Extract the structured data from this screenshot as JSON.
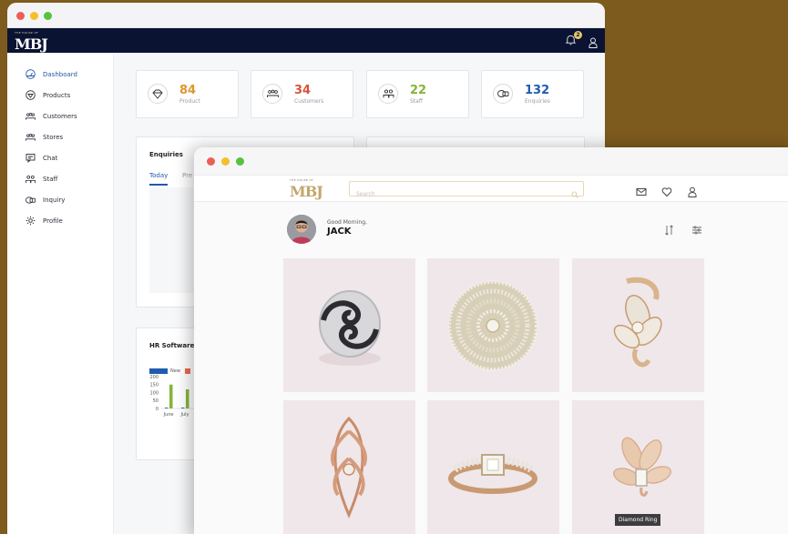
{
  "admin": {
    "logo_small": "THE HOUSE OF",
    "logo_big": "MBJ",
    "notification_count": "2",
    "sidebar": [
      {
        "label": "Dashboard",
        "icon": "dashboard-icon"
      },
      {
        "label": "Products",
        "icon": "diamond-icon"
      },
      {
        "label": "Customers",
        "icon": "people-icon"
      },
      {
        "label": "Stores",
        "icon": "store-icon"
      },
      {
        "label": "Chat",
        "icon": "chat-icon"
      },
      {
        "label": "Staff",
        "icon": "staff-icon"
      },
      {
        "label": "Inquiry",
        "icon": "inquiry-icon"
      },
      {
        "label": "Profile",
        "icon": "gear-icon"
      }
    ],
    "stats": [
      {
        "value": "84",
        "label": "Product",
        "color": "#e0962b"
      },
      {
        "value": "34",
        "label": "Customers",
        "color": "#d7543b"
      },
      {
        "value": "22",
        "label": "Staff",
        "color": "#86b33a"
      },
      {
        "value": "132",
        "label": "Enquiries",
        "color": "#1f5bb0"
      }
    ],
    "enquiries": {
      "title": "Enquiries",
      "tab_today": "Today",
      "tab_prev": "Pre"
    },
    "hr": {
      "title": "HR Software",
      "legend_new": "New",
      "chart_data": {
        "type": "bar",
        "categories": [
          "June",
          "July"
        ],
        "series": [
          {
            "name": "New",
            "values": [
              5,
              5
            ]
          },
          {
            "values": [
              150,
              120
            ]
          }
        ],
        "yticks": [
          "200",
          "150",
          "100",
          "50",
          "0"
        ],
        "ylim": [
          0,
          200
        ],
        "colors": [
          "#1f5bb0",
          "#86b33a"
        ]
      }
    }
  },
  "shop": {
    "logo_small": "THE HOUSE OF",
    "logo_big": "MBJ",
    "search_placeholder": "Search",
    "greeting": "Good Morning,",
    "user_name": "JACK",
    "tooltip": "Diamond Ring"
  }
}
